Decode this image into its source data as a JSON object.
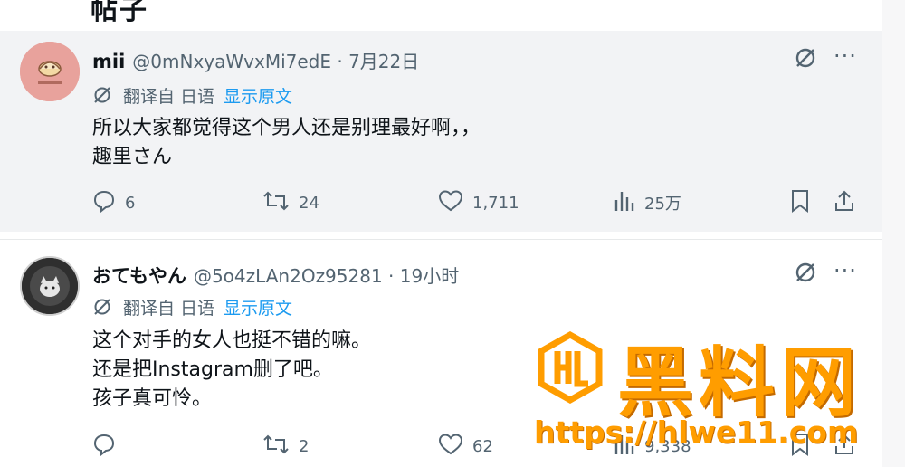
{
  "top_fragment": "帖子",
  "posts": [
    {
      "name": "mii",
      "handle": "@0mNxyaWvxMi7edE · 7月22日",
      "translate": {
        "label": "翻译自 日语",
        "show_original": "显示原文"
      },
      "lines": [
        "所以大家都觉得这个男人还是别理最好啊，，",
        "趣里さん"
      ],
      "replies": "6",
      "reposts": "24",
      "likes": "1,711",
      "views": "25万"
    },
    {
      "name": "おてもやん",
      "handle": "@5o4zLAn2Oz95281 · 19小时",
      "translate": {
        "label": "翻译自 日语",
        "show_original": "显示原文"
      },
      "lines": [
        "这个对手的女人也挺不错的嘛。",
        "还是把Instagram删了吧。",
        "孩子真可怜。"
      ],
      "replies": "",
      "reposts": "2",
      "likes": "62",
      "views": "9,338"
    }
  ],
  "more_glyph": "···",
  "watermark": {
    "title": "黑料网",
    "url": "https://hlwe11.com"
  },
  "colors": {
    "accent": "#1d9bf0",
    "muted": "#536471",
    "text": "#0f1419",
    "watermark": "#ff9d00"
  }
}
